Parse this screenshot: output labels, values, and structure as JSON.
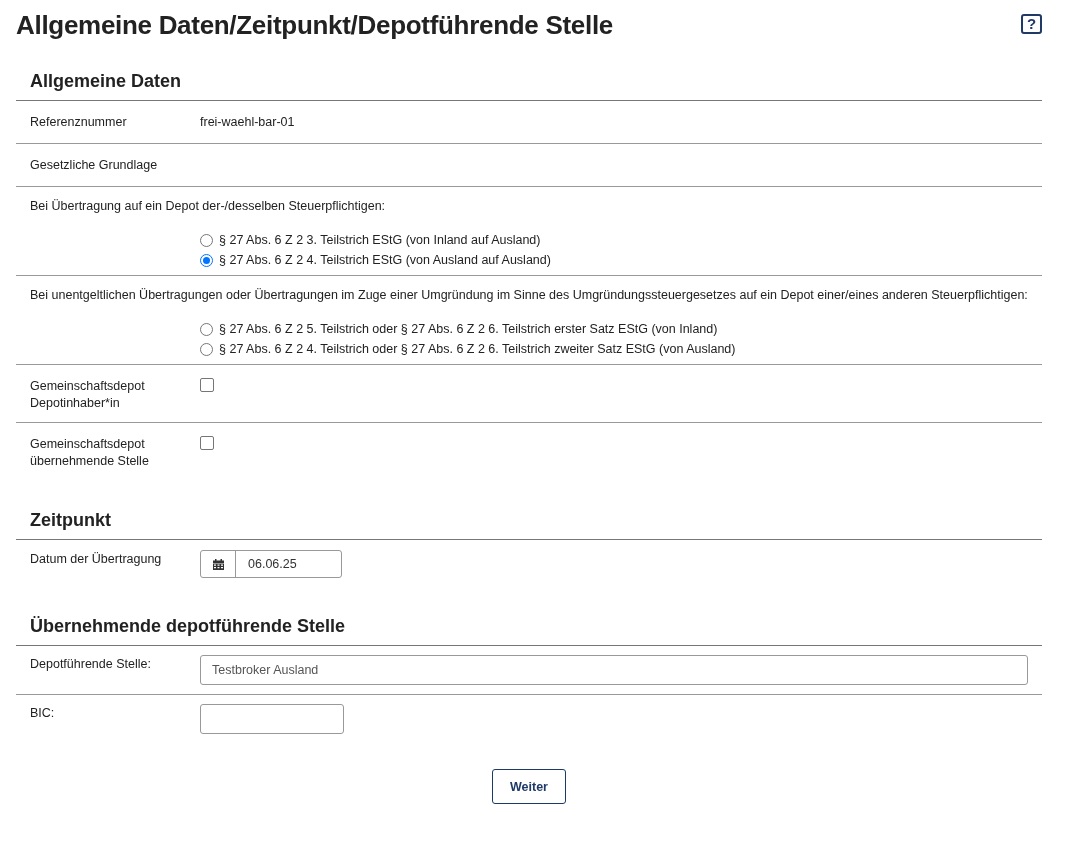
{
  "title": "Allgemeine Daten/Zeitpunkt/Depotführende Stelle",
  "help_button": {
    "label": "?"
  },
  "sections": [
    {
      "heading": "Allgemeine Daten",
      "rows": [
        {
          "kind": "text",
          "label": "Referenznummer",
          "value": "frei-waehl-bar-01"
        },
        {
          "kind": "text",
          "label": "Gesetzliche Grundlage"
        },
        {
          "kind": "radio",
          "prompt": "Bei Übertragung auf ein Depot der-/desselben Steuerpflichtigen:",
          "options": [
            {
              "label": "§ 27 Abs. 6 Z 2 3. Teilstrich EStG (von Inland auf Ausland)",
              "selected": false
            },
            {
              "label": "§ 27 Abs. 6 Z 2 4. Teilstrich EStG (von Ausland auf Ausland)",
              "selected": true
            }
          ]
        },
        {
          "kind": "radio",
          "prompt": "Bei unentgeltlichen Übertragungen oder Übertragungen im Zuge einer Umgründung im Sinne des Umgründungssteuergesetzes auf ein Depot einer/eines anderen Steuerpflichtigen:",
          "options": [
            {
              "label": "§ 27 Abs. 6 Z 2 5. Teilstrich oder § 27 Abs. 6 Z 2 6. Teilstrich erster Satz EStG (von Inland)",
              "selected": false
            },
            {
              "label": "§ 27 Abs. 6 Z 2 4. Teilstrich oder § 27 Abs. 6 Z 2 6. Teilstrich zweiter Satz EStG (von Ausland)",
              "selected": false
            }
          ]
        },
        {
          "kind": "checkbox",
          "label": "Gemeinschaftsdepot Depotinhaber*in",
          "checked": false
        },
        {
          "kind": "checkbox",
          "label": "Gemeinschaftsdepot übernehmende Stelle",
          "checked": false
        }
      ]
    },
    {
      "heading": "Zeitpunkt",
      "rows": [
        {
          "kind": "date",
          "label": "Datum der Übertragung",
          "value": "06.06.25"
        }
      ]
    },
    {
      "heading": "Übernehmende depotführende Stelle",
      "rows": [
        {
          "kind": "input",
          "label": "Depotführende Stelle:",
          "value": "Testbroker Ausland",
          "wide": true
        },
        {
          "kind": "input",
          "label": "BIC:",
          "wide": false
        }
      ]
    }
  ],
  "submit_button": {
    "label": "Weiter"
  }
}
